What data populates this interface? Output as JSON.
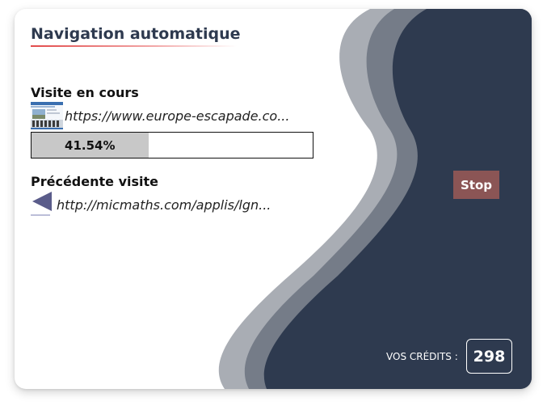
{
  "colors": {
    "panel_dark": "#2e3a4f",
    "wave_mid": "#757c88",
    "wave_light": "#a9adb4",
    "stop_button": "#8b5555",
    "progress_fill": "#c8c8c8",
    "title_underline": "#e24b4b"
  },
  "header": {
    "title": "Navigation automatique"
  },
  "current_visit": {
    "label": "Visite en cours",
    "url": "https://www.europe-escapade.co...",
    "thumbnail_icon": "website-thumbnail-icon",
    "progress_text": "41.54%",
    "progress_fraction": 0.4154
  },
  "previous_visit": {
    "label": "Précédente visite",
    "url": "http://micmaths.com/applis/lgn...",
    "thumbnail_icon": "triangle-thumbnail-icon"
  },
  "controls": {
    "stop_label": "Stop"
  },
  "credits": {
    "label": "VOS CRÉDITS :",
    "value": "298"
  }
}
